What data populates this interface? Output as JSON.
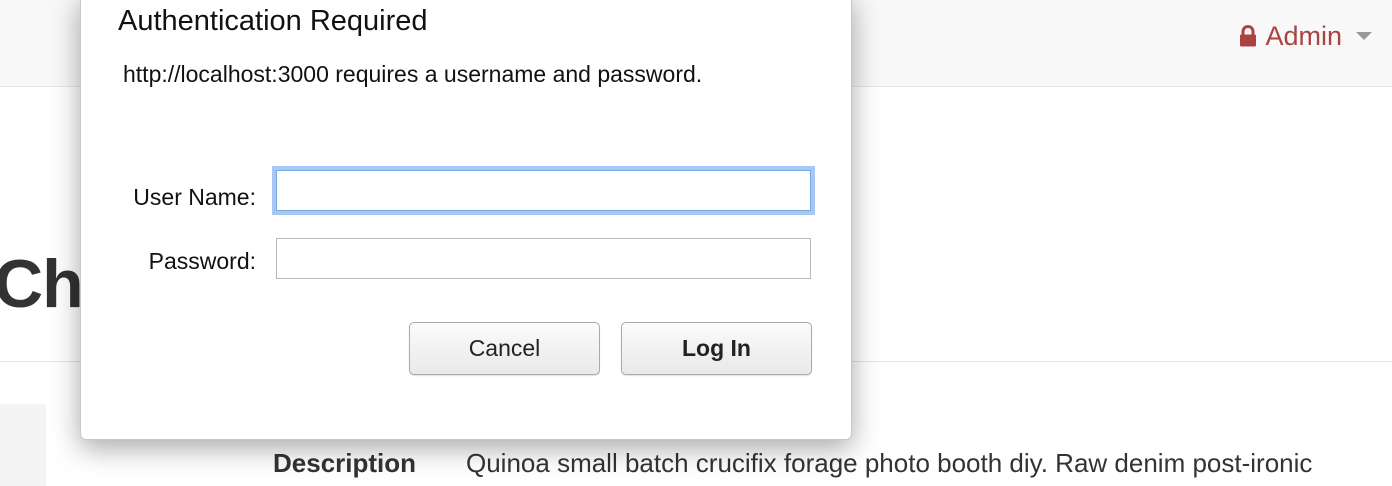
{
  "navbar": {
    "user_menu_label": "Admin",
    "user_icon": "lock-icon",
    "accent_color": "#a94442"
  },
  "page": {
    "title_fragment": "Cha",
    "description_label": "Description",
    "description_value": "Quinoa small batch crucifix forage photo booth diy. Raw denim post-ironic"
  },
  "auth_dialog": {
    "title": "Authentication Required",
    "message": "http://localhost:3000 requires a username and password.",
    "username_label": "User Name:",
    "username_value": "",
    "password_label": "Password:",
    "password_value": "",
    "cancel_label": "Cancel",
    "login_label": "Log In",
    "focus_color": "#a6c8f2"
  }
}
